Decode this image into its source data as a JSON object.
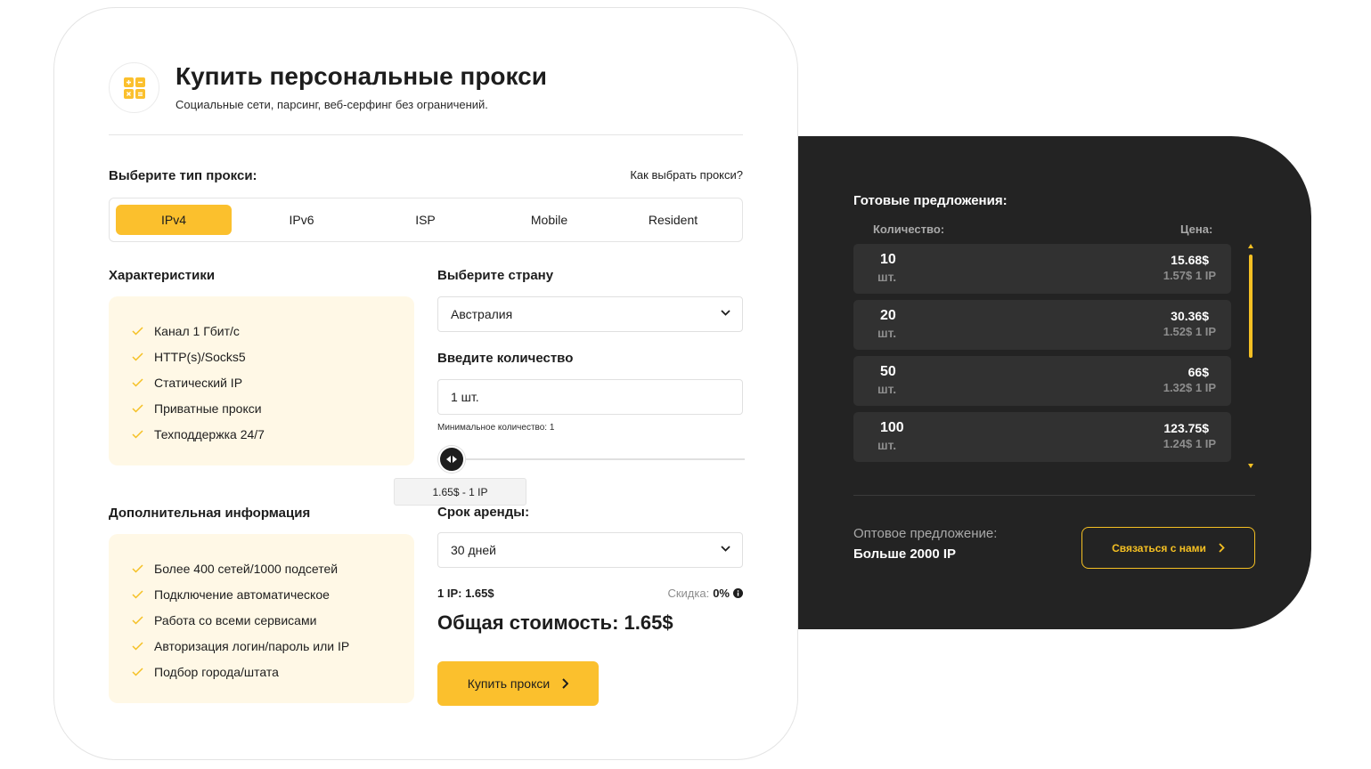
{
  "header": {
    "title": "Купить персональные прокси",
    "subtitle": "Социальные сети, парсинг, веб-серфинг без ограничений."
  },
  "proxy_type": {
    "label": "Выберите тип прокси:",
    "help_link": "Как выбрать прокси?",
    "tabs": [
      {
        "label": "IPv4",
        "active": true
      },
      {
        "label": "IPv6",
        "active": false
      },
      {
        "label": "ISP",
        "active": false
      },
      {
        "label": "Mobile",
        "active": false
      },
      {
        "label": "Resident",
        "active": false
      }
    ]
  },
  "characteristics": {
    "title": "Характеристики",
    "items": [
      "Канал 1 Гбит/с",
      "HTTP(s)/Socks5",
      "Статический IP",
      "Приватные прокси",
      "Техподдержка 24/7"
    ]
  },
  "extra_info": {
    "title": "Дополнительная информация",
    "items": [
      "Более 400 сетей/1000 подсетей",
      "Подключение автоматическое",
      "Работа со всеми сервисами",
      "Авторизация логин/пароль или IP",
      "Подбор города/штата"
    ]
  },
  "country": {
    "label": "Выберите страну",
    "selected": "Австралия"
  },
  "quantity": {
    "label": "Введите количество",
    "value": "1 шт.",
    "min_note": "Минимальное количество: 1",
    "slider_tooltip": "1.65$ - 1 IP"
  },
  "rent": {
    "label": "Срок аренды:",
    "selected": "30 дней"
  },
  "pricing": {
    "ip_price": "1 IP: 1.65$",
    "discount_label": "Скидка:",
    "discount_value": "0%",
    "total": "Общая стоимость: 1.65$",
    "buy_button": "Купить прокси"
  },
  "offers_panel": {
    "title": "Готовые предложения:",
    "col_qty": "Количество:",
    "col_price": "Цена:",
    "offers": [
      {
        "qty": "10",
        "unit": "шт.",
        "price": "15.68$",
        "per_ip": "1.57$ 1 IP"
      },
      {
        "qty": "20",
        "unit": "шт.",
        "price": "30.36$",
        "per_ip": "1.52$ 1 IP"
      },
      {
        "qty": "50",
        "unit": "шт.",
        "price": "66$",
        "per_ip": "1.32$ 1 IP"
      },
      {
        "qty": "100",
        "unit": "шт.",
        "price": "123.75$",
        "per_ip": "1.24$ 1 IP"
      }
    ],
    "wholesale_label": "Оптовое предложение:",
    "wholesale_value": "Больше 2000 IP",
    "contact_button": "Связаться с нами"
  },
  "colors": {
    "accent": "#fbc02d",
    "dark_panel": "#232323",
    "feature_bg": "#fff8e6"
  },
  "icons": {
    "logo": "calculator-icon",
    "check": "checkmark-icon",
    "dropdown": "chevron-down-icon",
    "button_arrow": "chevron-right-icon",
    "info": "info-icon"
  }
}
